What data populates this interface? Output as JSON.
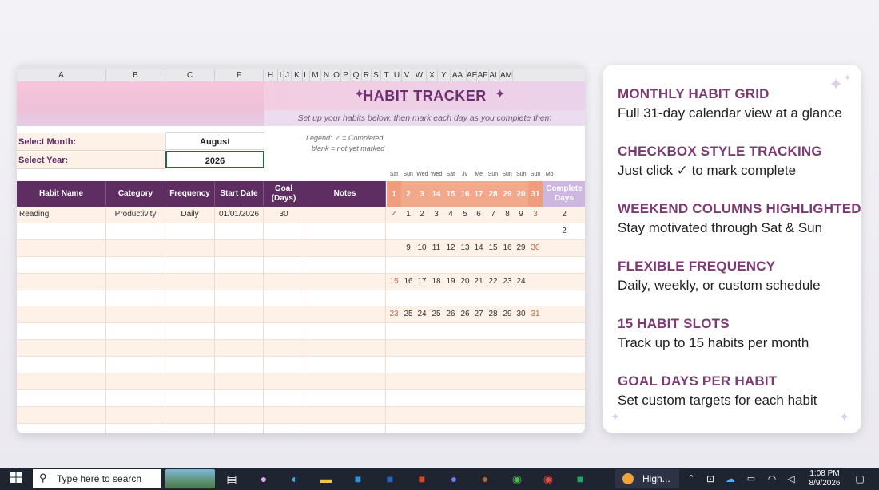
{
  "sheet": {
    "col_letters": [
      "A",
      "B",
      "C",
      "F",
      "H",
      "I",
      "J",
      "K",
      "L",
      "M",
      "N",
      "O",
      "P",
      "Q",
      "R",
      "S",
      "T",
      "U",
      "V",
      "W",
      "X",
      "Y",
      "AA",
      "AE",
      "AF",
      "AL",
      "AM"
    ],
    "title": "HABIT TRACKER",
    "subtitle": "Set up your habits below, then mark each day as you complete them",
    "select_month_label": "Select Month:",
    "select_month_value": "August",
    "select_year_label": "Select Year:",
    "select_year_value": "2026",
    "legend_line1": "Legend:  ✓ = Completed",
    "legend_line2": "blank = not yet marked",
    "weekday_labels": [
      "Sat",
      "Sun",
      "Wed",
      "Wed",
      "Sat",
      "Jv",
      "Me",
      "Sun",
      "Sun",
      "Sun",
      "Sun",
      "Mo"
    ],
    "headers": {
      "habit_name": "Habit Name",
      "category": "Category",
      "frequency": "Frequency",
      "start_date": "Start Date",
      "goal_days": "Goal (Days)",
      "notes": "Notes",
      "complete_days": "Complete Days"
    },
    "day_headers": [
      "1",
      "2",
      "3",
      "14",
      "15",
      "16",
      "17",
      "28",
      "29",
      "20",
      "31"
    ],
    "rows": [
      {
        "habit": "Reading",
        "category": "Productivity",
        "frequency": "Daily",
        "start": "01/01/2026",
        "goal": "30",
        "notes": "",
        "days": [
          "✓",
          "1",
          "2",
          "3",
          "4",
          "5",
          "6",
          "7",
          "8",
          "9",
          "3"
        ],
        "complete": "2"
      },
      {
        "habit": "",
        "category": "",
        "frequency": "",
        "start": "",
        "goal": "",
        "notes": "",
        "days": [
          "",
          "",
          "",
          "",
          "",
          "",
          "",
          "",
          "",
          "",
          ""
        ],
        "complete": "2"
      },
      {
        "habit": "",
        "category": "",
        "frequency": "",
        "start": "",
        "goal": "",
        "notes": "",
        "days": [
          "",
          "9",
          "10",
          "11",
          "12",
          "13",
          "14",
          "15",
          "16",
          "29",
          "30"
        ],
        "complete": ""
      },
      {
        "habit": "",
        "category": "",
        "frequency": "",
        "start": "",
        "goal": "",
        "notes": "",
        "days": [
          "",
          "",
          "",
          "",
          "",
          "",
          "",
          "",
          "",
          "",
          ""
        ],
        "complete": ""
      },
      {
        "habit": "",
        "category": "",
        "frequency": "",
        "start": "",
        "goal": "",
        "notes": "",
        "days": [
          "15",
          "16",
          "17",
          "18",
          "19",
          "20",
          "21",
          "22",
          "23",
          "24",
          ""
        ],
        "complete": ""
      },
      {
        "habit": "",
        "category": "",
        "frequency": "",
        "start": "",
        "goal": "",
        "notes": "",
        "days": [
          "",
          "",
          "",
          "",
          "",
          "",
          "",
          "",
          "",
          "",
          ""
        ],
        "complete": ""
      },
      {
        "habit": "",
        "category": "",
        "frequency": "",
        "start": "",
        "goal": "",
        "notes": "",
        "days": [
          "23",
          "25",
          "24",
          "25",
          "26",
          "26",
          "27",
          "28",
          "29",
          "30",
          "31"
        ],
        "complete": ""
      },
      {
        "habit": "",
        "category": "",
        "frequency": "",
        "start": "",
        "goal": "",
        "notes": "",
        "days": [
          "",
          "",
          "",
          "",
          "",
          "",
          "",
          "",
          "",
          "",
          ""
        ],
        "complete": ""
      },
      {
        "habit": "",
        "category": "",
        "frequency": "",
        "start": "",
        "goal": "",
        "notes": "",
        "days": [
          "",
          "",
          "",
          "",
          "",
          "",
          "",
          "",
          "",
          "",
          ""
        ],
        "complete": ""
      },
      {
        "habit": "",
        "category": "",
        "frequency": "",
        "start": "",
        "goal": "",
        "notes": "",
        "days": [
          "",
          "",
          "",
          "",
          "",
          "",
          "",
          "",
          "",
          "",
          ""
        ],
        "complete": ""
      },
      {
        "habit": "",
        "category": "",
        "frequency": "",
        "start": "",
        "goal": "",
        "notes": "",
        "days": [
          "",
          "",
          "",
          "",
          "",
          "",
          "",
          "",
          "",
          "",
          ""
        ],
        "complete": ""
      },
      {
        "habit": "",
        "category": "",
        "frequency": "",
        "start": "",
        "goal": "",
        "notes": "",
        "days": [
          "",
          "",
          "",
          "",
          "",
          "",
          "",
          "",
          "",
          "",
          ""
        ],
        "complete": ""
      },
      {
        "habit": "",
        "category": "",
        "frequency": "",
        "start": "",
        "goal": "",
        "notes": "",
        "days": [
          "",
          "",
          "",
          "",
          "",
          "",
          "",
          "",
          "",
          "",
          ""
        ],
        "complete": ""
      },
      {
        "habit": "",
        "category": "",
        "frequency": "",
        "start": "",
        "goal": "",
        "notes": "",
        "days": [
          "",
          "",
          "",
          "",
          "",
          "",
          "",
          "",
          "",
          "",
          ""
        ],
        "complete": ""
      }
    ]
  },
  "features": [
    {
      "title": "MONTHLY HABIT GRID",
      "desc": "Full 31-day calendar view at a glance"
    },
    {
      "title": "CHECKBOX STYLE TRACKING",
      "desc": "Just click ✓ to mark complete"
    },
    {
      "title": "WEEKEND COLUMNS HIGHLIGHTED",
      "desc": "Stay motivated through Sat & Sun"
    },
    {
      "title": "FLEXIBLE FREQUENCY",
      "desc": "Daily, weekly, or custom schedule"
    },
    {
      "title": "15 HABIT SLOTS",
      "desc": "Track up to 15 habits per month"
    },
    {
      "title": "GOAL DAYS PER HABIT",
      "desc": "Set custom targets for each habit"
    }
  ],
  "taskbar": {
    "search_placeholder": "Type here to search",
    "app_label": "High...",
    "time": "1:08 PM",
    "date": "8/9/2026"
  },
  "colors": {
    "title_purple": "#6b2f72",
    "header_purple": "#5e2e62",
    "feature_title": "#7d3a73",
    "weekend_shade": "#f6c4ad",
    "row_tint": "#fdf1e8"
  }
}
